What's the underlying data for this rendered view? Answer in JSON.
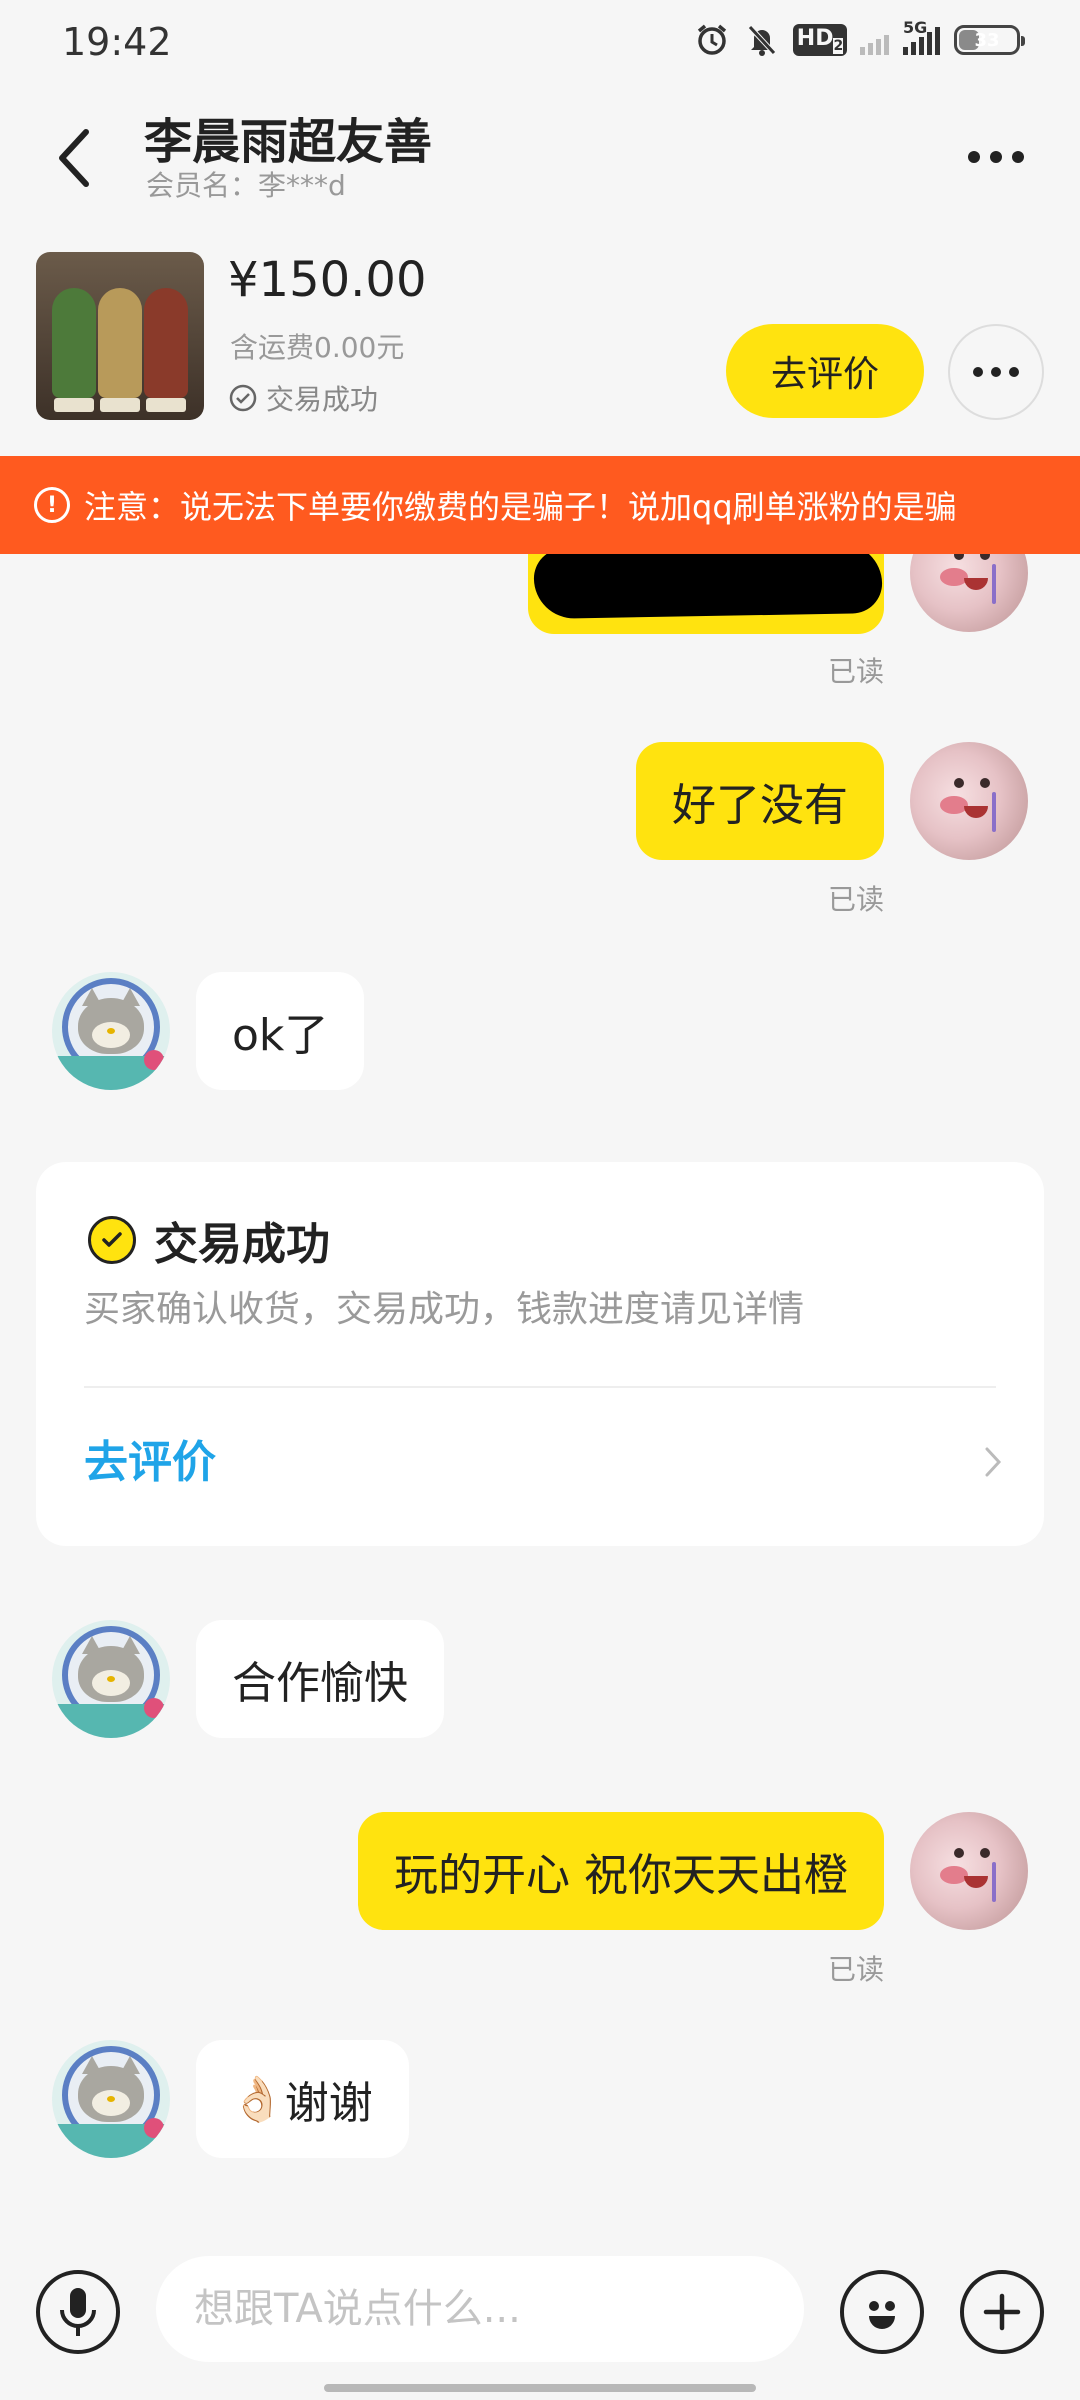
{
  "status_bar": {
    "time": "19:42",
    "battery": "33",
    "network": "5G",
    "hd": "HD",
    "hd_sub": "2"
  },
  "header": {
    "title": "李晨雨超友善",
    "member": "会员名：李***d"
  },
  "product": {
    "price": "¥150.00",
    "shipping": "含运费0.00元",
    "status": "交易成功",
    "eval_button": "去评价"
  },
  "warning": {
    "text": "注意：说无法下单要你缴费的是骗子！说加qq刷单涨粉的是骗"
  },
  "messages": {
    "read_label": "已读",
    "m1": "好了没有",
    "m2": "ok了",
    "m3": "合作愉快",
    "m4": "玩的开心 祝你天天出橙",
    "m5_emoji": "👌🏻",
    "m5": "谢谢"
  },
  "deal_card": {
    "title": "交易成功",
    "description": "买家确认收货，交易成功，钱款进度请见详情",
    "link": "去评价"
  },
  "input": {
    "placeholder": "想跟TA说点什么..."
  },
  "colors": {
    "accent": "#ffe30f",
    "warning": "#ff5a1f",
    "link": "#1fa4e8",
    "background": "#f6f6f6"
  }
}
